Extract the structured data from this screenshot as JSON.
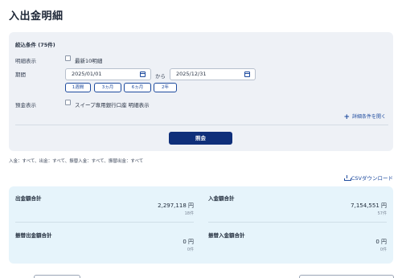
{
  "page": {
    "title": "入出金明細"
  },
  "filter": {
    "heading": "絞込条件 (75件)",
    "display_label": "明細表示",
    "latest10_label": "最新10明細",
    "period_label": "期間",
    "date_from": "2025/01/01",
    "from_word": "から",
    "date_to": "2025/12/31",
    "period_buttons": [
      "1週間",
      "3ヵ月",
      "6ヵ月",
      "2年"
    ],
    "deposit_label": "預金表示",
    "sweep_label": "スイープ専用銀行口座 明細表示",
    "expand_label": "詳細条件を開く",
    "search_button": "照会"
  },
  "summary_text": "入金：すべて、出金：すべて、振替入金：すべて、振替出金：すべて",
  "csv_label": "CSVダウンロード",
  "totals": {
    "withdrawal": {
      "label": "出金額合計",
      "amount": "2,297,118 円",
      "count": "18件"
    },
    "deposit": {
      "label": "入金額合計",
      "amount": "7,154,551 円",
      "count": "57件"
    },
    "transfer_out": {
      "label": "振替出金額合計",
      "amount": "0 円",
      "count": "0件"
    },
    "transfer_in": {
      "label": "振替入金額合計",
      "amount": "0 円",
      "count": "0件"
    }
  },
  "colors": {
    "primary": "#0f2f7a",
    "accent": "#1d4a9e",
    "filter_bg": "#eef1f6",
    "totals_bg": "#e6f4fb"
  },
  "icons": {
    "calendar": "calendar-icon",
    "plus": "plus-icon",
    "download": "download-icon"
  }
}
